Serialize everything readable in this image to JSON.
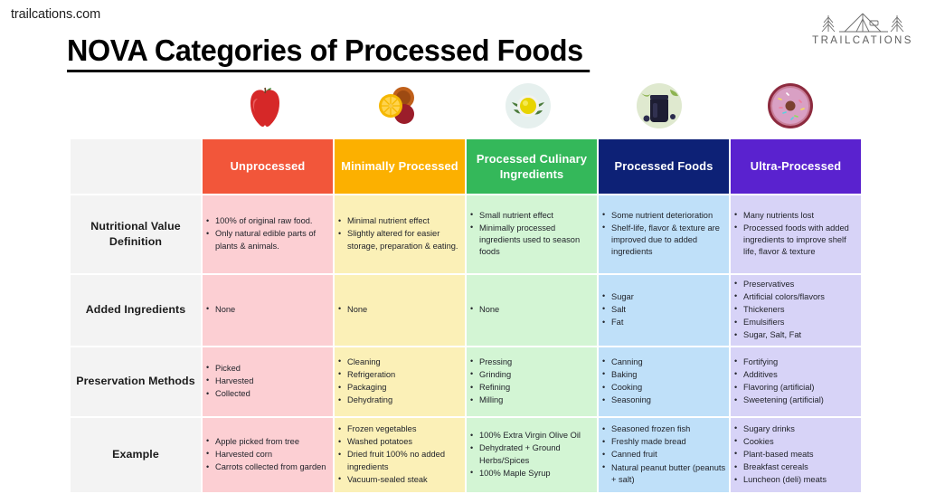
{
  "site_url": "trailcations.com",
  "logo": {
    "wordmark": "TRAILCATIONS",
    "icon": "tent-with-pine-trees-icon"
  },
  "title": "NOVA Categories of Processed Foods",
  "food_images": [
    {
      "name": "apple-image",
      "alt": "red apple"
    },
    {
      "name": "dried-citrus-image",
      "alt": "dried orange and citrus slices"
    },
    {
      "name": "olive-oil-bowl-image",
      "alt": "bowl of olive oil with herbs"
    },
    {
      "name": "jam-jar-image",
      "alt": "jar of dark berry jam"
    },
    {
      "name": "donut-image",
      "alt": "pink frosted donut with sprinkles"
    }
  ],
  "table": {
    "corner_label": "",
    "columns": [
      {
        "label": "Unprocessed",
        "header_color": "#f2563a",
        "cell_color": "#fccfd3"
      },
      {
        "label": "Minimally Processed",
        "header_color": "#fcb000",
        "cell_color": "#fbf0b7"
      },
      {
        "label": "Processed Culinary Ingredients",
        "header_color": "#34b85a",
        "cell_color": "#d3f5d4"
      },
      {
        "label": "Processed Foods",
        "header_color": "#0d2176",
        "cell_color": "#bfe0f9"
      },
      {
        "label": "Ultra-Processed",
        "header_color": "#5a22cf",
        "cell_color": "#d7d3f7"
      }
    ],
    "rows": [
      {
        "label": "Nutritional Value Definition",
        "cells": [
          [
            "100% of original raw food.",
            "Only natural edible parts of plants & animals."
          ],
          [
            "Minimal nutrient effect",
            "Slightly altered for easier storage, preparation & eating."
          ],
          [
            "Small nutrient effect",
            "Minimally processed ingredients used to season foods"
          ],
          [
            "Some nutrient deterioration",
            "Shelf-life, flavor & texture are improved due to added ingredients"
          ],
          [
            "Many nutrients lost",
            "Processed foods with added ingredients to improve shelf life, flavor & texture"
          ]
        ]
      },
      {
        "label": "Added Ingredients",
        "cells": [
          [
            "None"
          ],
          [
            "None"
          ],
          [
            "None"
          ],
          [
            "Sugar",
            "Salt",
            "Fat"
          ],
          [
            "Preservatives",
            "Artificial colors/flavors",
            "Thickeners",
            "Emulsifiers",
            "Sugar, Salt, Fat"
          ]
        ]
      },
      {
        "label": "Preservation Methods",
        "cells": [
          [
            "Picked",
            "Harvested",
            "Collected"
          ],
          [
            "Cleaning",
            "Refrigeration",
            "Packaging",
            "Dehydrating"
          ],
          [
            "Pressing",
            "Grinding",
            "Refining",
            "Milling"
          ],
          [
            "Canning",
            "Baking",
            "Cooking",
            "Seasoning"
          ],
          [
            "Fortifying",
            "Additives",
            "Flavoring (artificial)",
            "Sweetening (artificial)"
          ]
        ]
      },
      {
        "label": "Example",
        "cells": [
          [
            "Apple picked from tree",
            "Harvested corn",
            "Carrots collected from garden"
          ],
          [
            "Frozen vegetables",
            "Washed potatoes",
            "Dried fruit 100% no added ingredients",
            "Vacuum-sealed steak"
          ],
          [
            "100% Extra Virgin Olive Oil",
            "Dehydrated + Ground Herbs/Spices",
            "100% Maple Syrup"
          ],
          [
            "Seasoned frozen fish",
            "Freshly made bread",
            "Canned fruit",
            "Natural peanut butter (peanuts + salt)"
          ],
          [
            "Sugary drinks",
            "Cookies",
            "Plant-based meats",
            "Breakfast cereals",
            "Luncheon (deli) meats"
          ]
        ]
      }
    ]
  }
}
